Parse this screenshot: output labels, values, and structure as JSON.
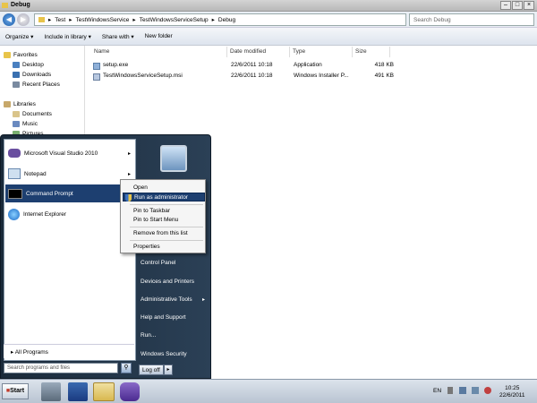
{
  "window": {
    "title": "Debug"
  },
  "address": {
    "back": "◀",
    "forward": "▶",
    "crumbs": [
      "Test",
      "TestWindowsService",
      "TestWindowsServiceSetup",
      "Debug"
    ],
    "search_placeholder": "Search Debug"
  },
  "toolbar": {
    "organize": "Organize ▾",
    "include": "Include in library ▾",
    "share": "Share with ▾",
    "newfolder": "New folder"
  },
  "nav": {
    "favorites": "Favorites",
    "desktop": "Desktop",
    "downloads": "Downloads",
    "recent": "Recent Places",
    "libraries": "Libraries",
    "documents": "Documents",
    "music": "Music",
    "pictures": "Pictures"
  },
  "columns": {
    "name": "Name",
    "date": "Date modified",
    "type": "Type",
    "size": "Size"
  },
  "files": [
    {
      "name": "setup.exe",
      "date": "22/6/2011 10:18",
      "type": "Application",
      "size": "418 KB"
    },
    {
      "name": "TestWindowsServiceSetup.msi",
      "date": "22/6/2011 10:18",
      "type": "Windows Installer P...",
      "size": "491 KB"
    }
  ],
  "start": {
    "programs": [
      "Microsoft Visual Studio 2010",
      "Notepad",
      "Command Prompt",
      "Internet Explorer"
    ],
    "all_programs": "All Programs",
    "search_placeholder": "Search programs and files",
    "right": [
      "Control Panel",
      "Devices and Printers",
      "Administrative Tools",
      "Help and Support",
      "Run...",
      "Windows Security"
    ],
    "logoff": "Log off"
  },
  "context": {
    "open": "Open",
    "runas": "Run as administrator",
    "pintaskbar": "Pin to Taskbar",
    "pinstart": "Pin to Start Menu",
    "remove": "Remove from this list",
    "properties": "Properties"
  },
  "taskbar": {
    "start": "Start",
    "lang": "EN",
    "time": "10:25",
    "date": "22/6/2011"
  }
}
